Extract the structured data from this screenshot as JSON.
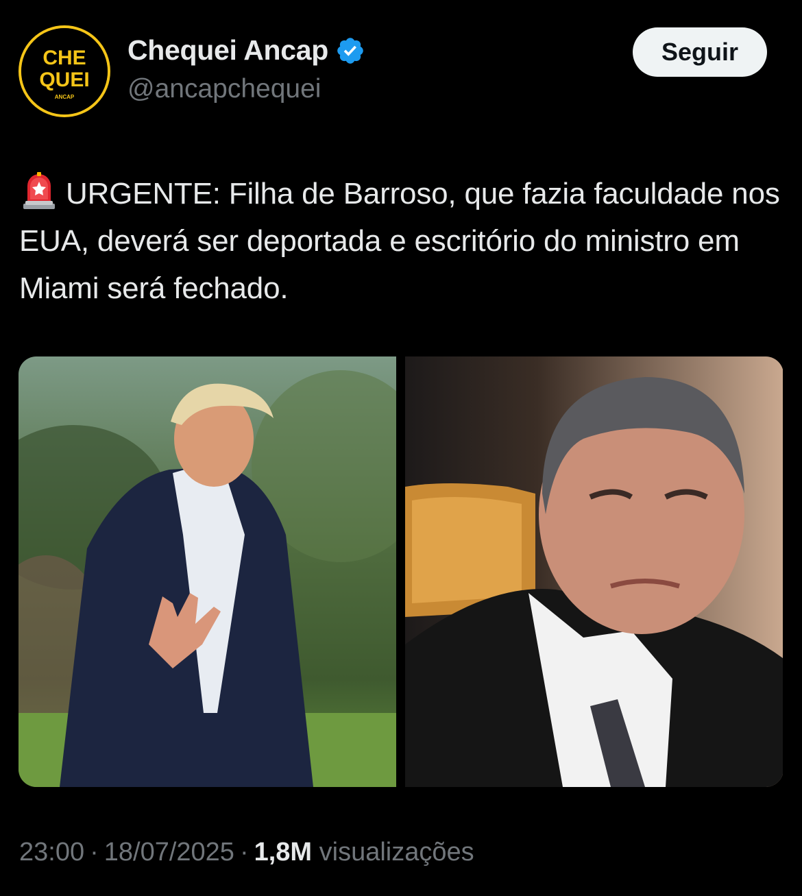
{
  "author": {
    "avatar_logo_text": [
      "CHE",
      "QUEI",
      "ANCAP"
    ],
    "display_name": "Chequei Ancap",
    "verified_icon": "verified-badge-icon",
    "handle": "@ancapchequei"
  },
  "follow_button": {
    "label": "Seguir"
  },
  "tweet": {
    "emoji": "siren-icon",
    "text": "URGENTE: Filha de Barroso, que fazia faculdade nos EUA, deverá ser deportada e escritório do ministro em Miami será fechado."
  },
  "media": {
    "count": 2
  },
  "meta": {
    "time": "23:00",
    "separator": "·",
    "date": "18/07/2025",
    "views_count": "1,8M",
    "views_label": "visualizações"
  },
  "colors": {
    "background": "#000000",
    "text_primary": "#e7e9ea",
    "text_secondary": "#71767b",
    "verified": "#1d9bf0",
    "logo_yellow": "#f5c518",
    "button_bg": "#eff3f4"
  }
}
